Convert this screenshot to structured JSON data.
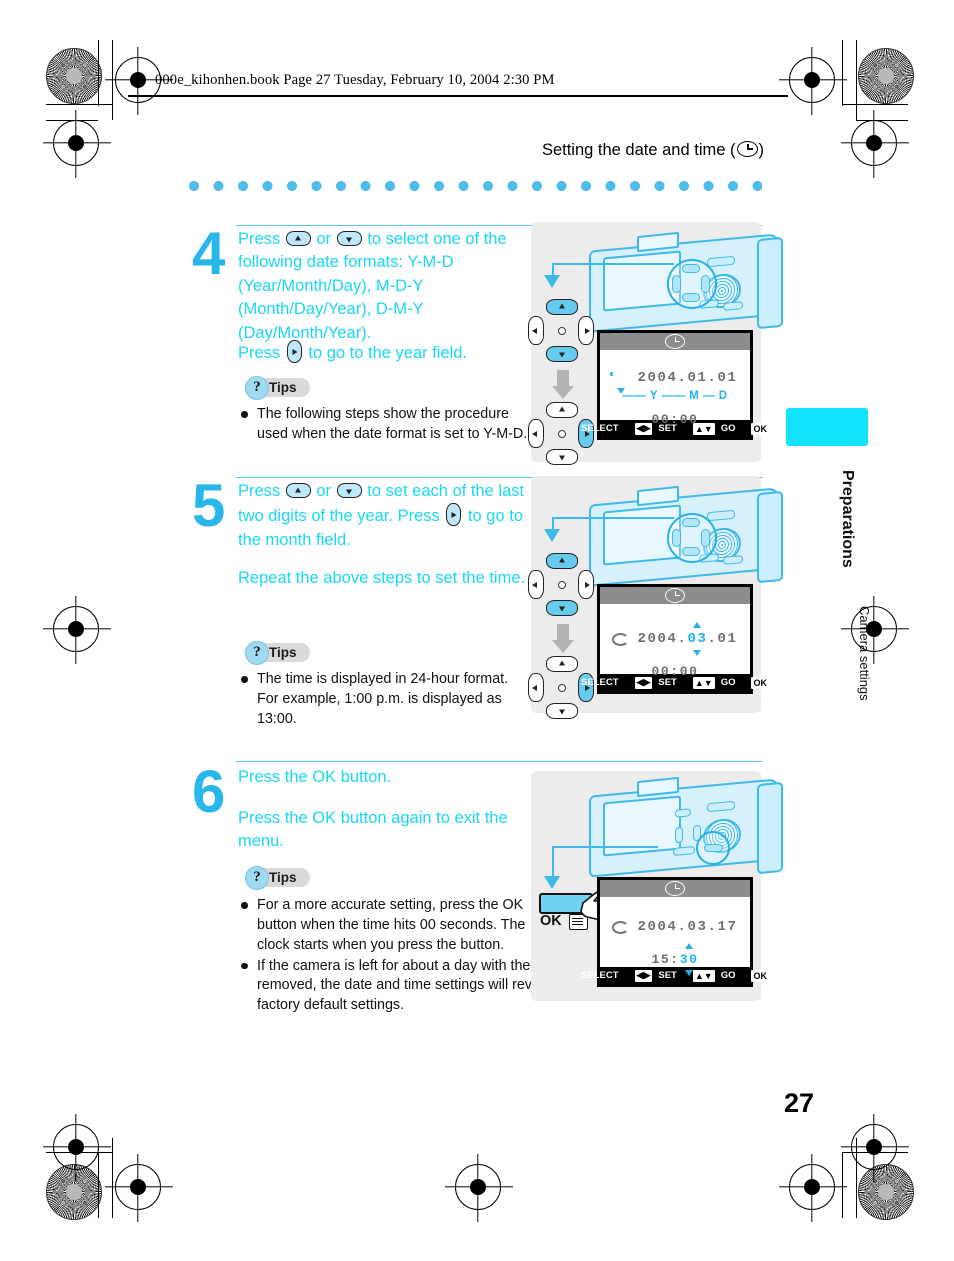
{
  "header": {
    "file_line": "000e_kihonhen.book  Page 27  Tuesday, February 10, 2004  2:30 PM"
  },
  "running_title": {
    "text": "Setting the date and time (",
    "text_end": ")",
    "icon": "clock-icon"
  },
  "steps": [
    {
      "number": "4",
      "paragraphs": [
        "Press  or  to select one of the following date formats: Y-M-D (Year/Month/Day), M-D-Y (Month/Day/Year), D-M-Y (Day/Month/Year).",
        "Press  to go to the year field."
      ],
      "p1_a": "Press",
      "p1_b": "or",
      "p1_c": "to select one of the following date formats: Y-M-D (Year/Month/Day), M-D-Y (Month/Day/Year), D-M-Y (Day/Month/Year).",
      "p2_a": "Press",
      "p2_b": "to go to the year field.",
      "tips_label": "Tips",
      "bullets": [
        "The following steps show the procedure used when the date format is set to Y-M-D."
      ],
      "screen": {
        "date": "2004.01.01",
        "format_y": "Y",
        "format_m": "M",
        "format_d": "D",
        "time": "00:00",
        "footer": {
          "select_label": "SELECT",
          "select_key": "◀▶",
          "set_label": "SET",
          "set_key": "▲▼",
          "go_label": "GO",
          "go_key": "OK"
        }
      }
    },
    {
      "number": "5",
      "p1_a": "Press",
      "p1_b": "or",
      "p1_c": "to set each of the last two digits of the year. Press",
      "p1_d": "to go to the month field.",
      "p2": "Repeat the above steps to set the time.",
      "tips_label": "Tips",
      "bullets": [
        "The time is displayed in 24-hour format. For example, 1:00 p.m. is displayed as 13:00."
      ],
      "screen": {
        "date_pre": "2004.",
        "date_hl": "03",
        "date_post": ".01",
        "time": "00:00",
        "footer": {
          "select_label": "SELECT",
          "select_key": "◀▶",
          "set_label": "SET",
          "set_key": "▲▼",
          "go_label": "GO",
          "go_key": "OK"
        }
      }
    },
    {
      "number": "6",
      "p1": "Press the OK button.",
      "p2": "Press the OK button again to exit the menu.",
      "tips_label": "Tips",
      "bullets": [
        "For a more accurate setting, press the OK button when the time hits 00 seconds. The clock starts when you press the button.",
        "If the camera is left for about a day with the battery removed, the date and time settings will revert to the factory default settings."
      ],
      "ok_callout_label": "OK",
      "screen": {
        "date": "2004.03.17",
        "time_pre": "15:",
        "time_hl": "30",
        "footer": {
          "select_label": "SELECT",
          "select_key": "◀▶",
          "set_label": "SET",
          "set_key": "▲▼",
          "go_label": "GO",
          "go_key": "OK"
        }
      }
    }
  ],
  "sidebar": {
    "tab_color": "#12e3ff",
    "section_title": "Preparations",
    "section_subtitle": "Camera settings"
  },
  "page_number": "27",
  "colors": {
    "cyan_text": "#19d7f5",
    "step_number": "#29b6e8",
    "dots": "#4ebdea",
    "highlight": "#1fb3e8"
  }
}
